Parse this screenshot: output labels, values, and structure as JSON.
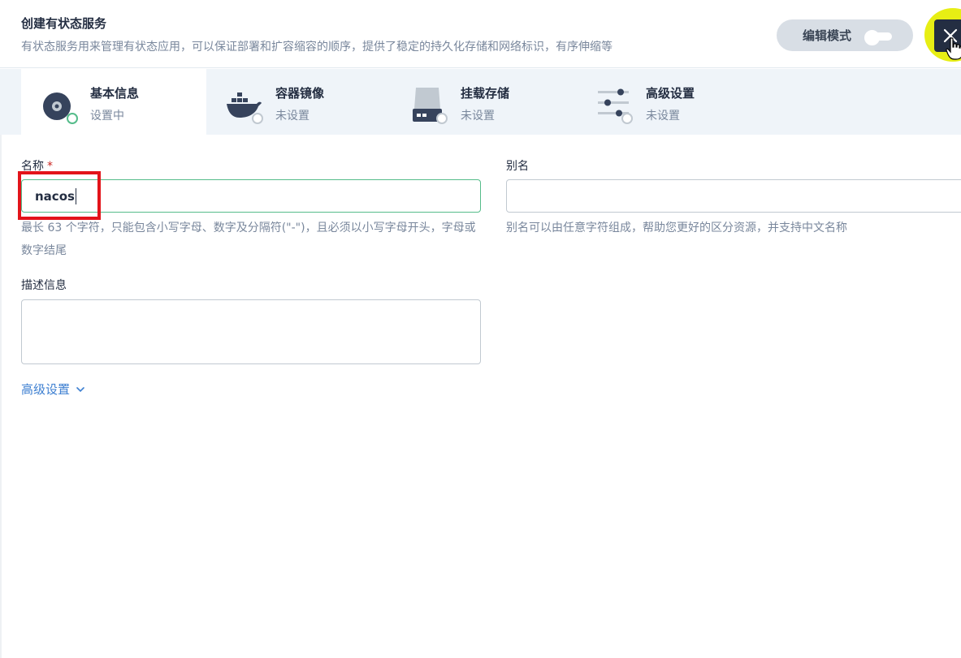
{
  "header": {
    "title": "创建有状态服务",
    "description": "有状态服务用来管理有状态应用，可以保证部署和扩容缩容的顺序，提供了稳定的持久化存储和网络标识，有序伸缩等",
    "edit_mode_label": "编辑模式"
  },
  "tabs": [
    {
      "label": "基本信息",
      "status": "设置中",
      "icon": "disk-icon",
      "active": true
    },
    {
      "label": "容器镜像",
      "status": "未设置",
      "icon": "docker-icon",
      "active": false
    },
    {
      "label": "挂载存储",
      "status": "未设置",
      "icon": "storage-icon",
      "active": false
    },
    {
      "label": "高级设置",
      "status": "未设置",
      "icon": "sliders-icon",
      "active": false
    }
  ],
  "form": {
    "name_label": "名称",
    "name_required_mark": "*",
    "name_value": "nacos",
    "name_help": "最长 63 个字符，只能包含小写字母、数字及分隔符(\"-\")，且必须以小写字母开头，字母或数字结尾",
    "alias_label": "别名",
    "alias_value": "",
    "alias_help": "别名可以由任意字符组成，帮助您更好的区分资源，并支持中文名称",
    "description_label": "描述信息",
    "description_value": "",
    "advanced_link": "高级设置"
  },
  "colors": {
    "accent_green": "#55bc8a",
    "link_blue": "#3d7fd1",
    "highlight_red": "#e3141a",
    "close_halo_yellow": "#e7ee14"
  }
}
